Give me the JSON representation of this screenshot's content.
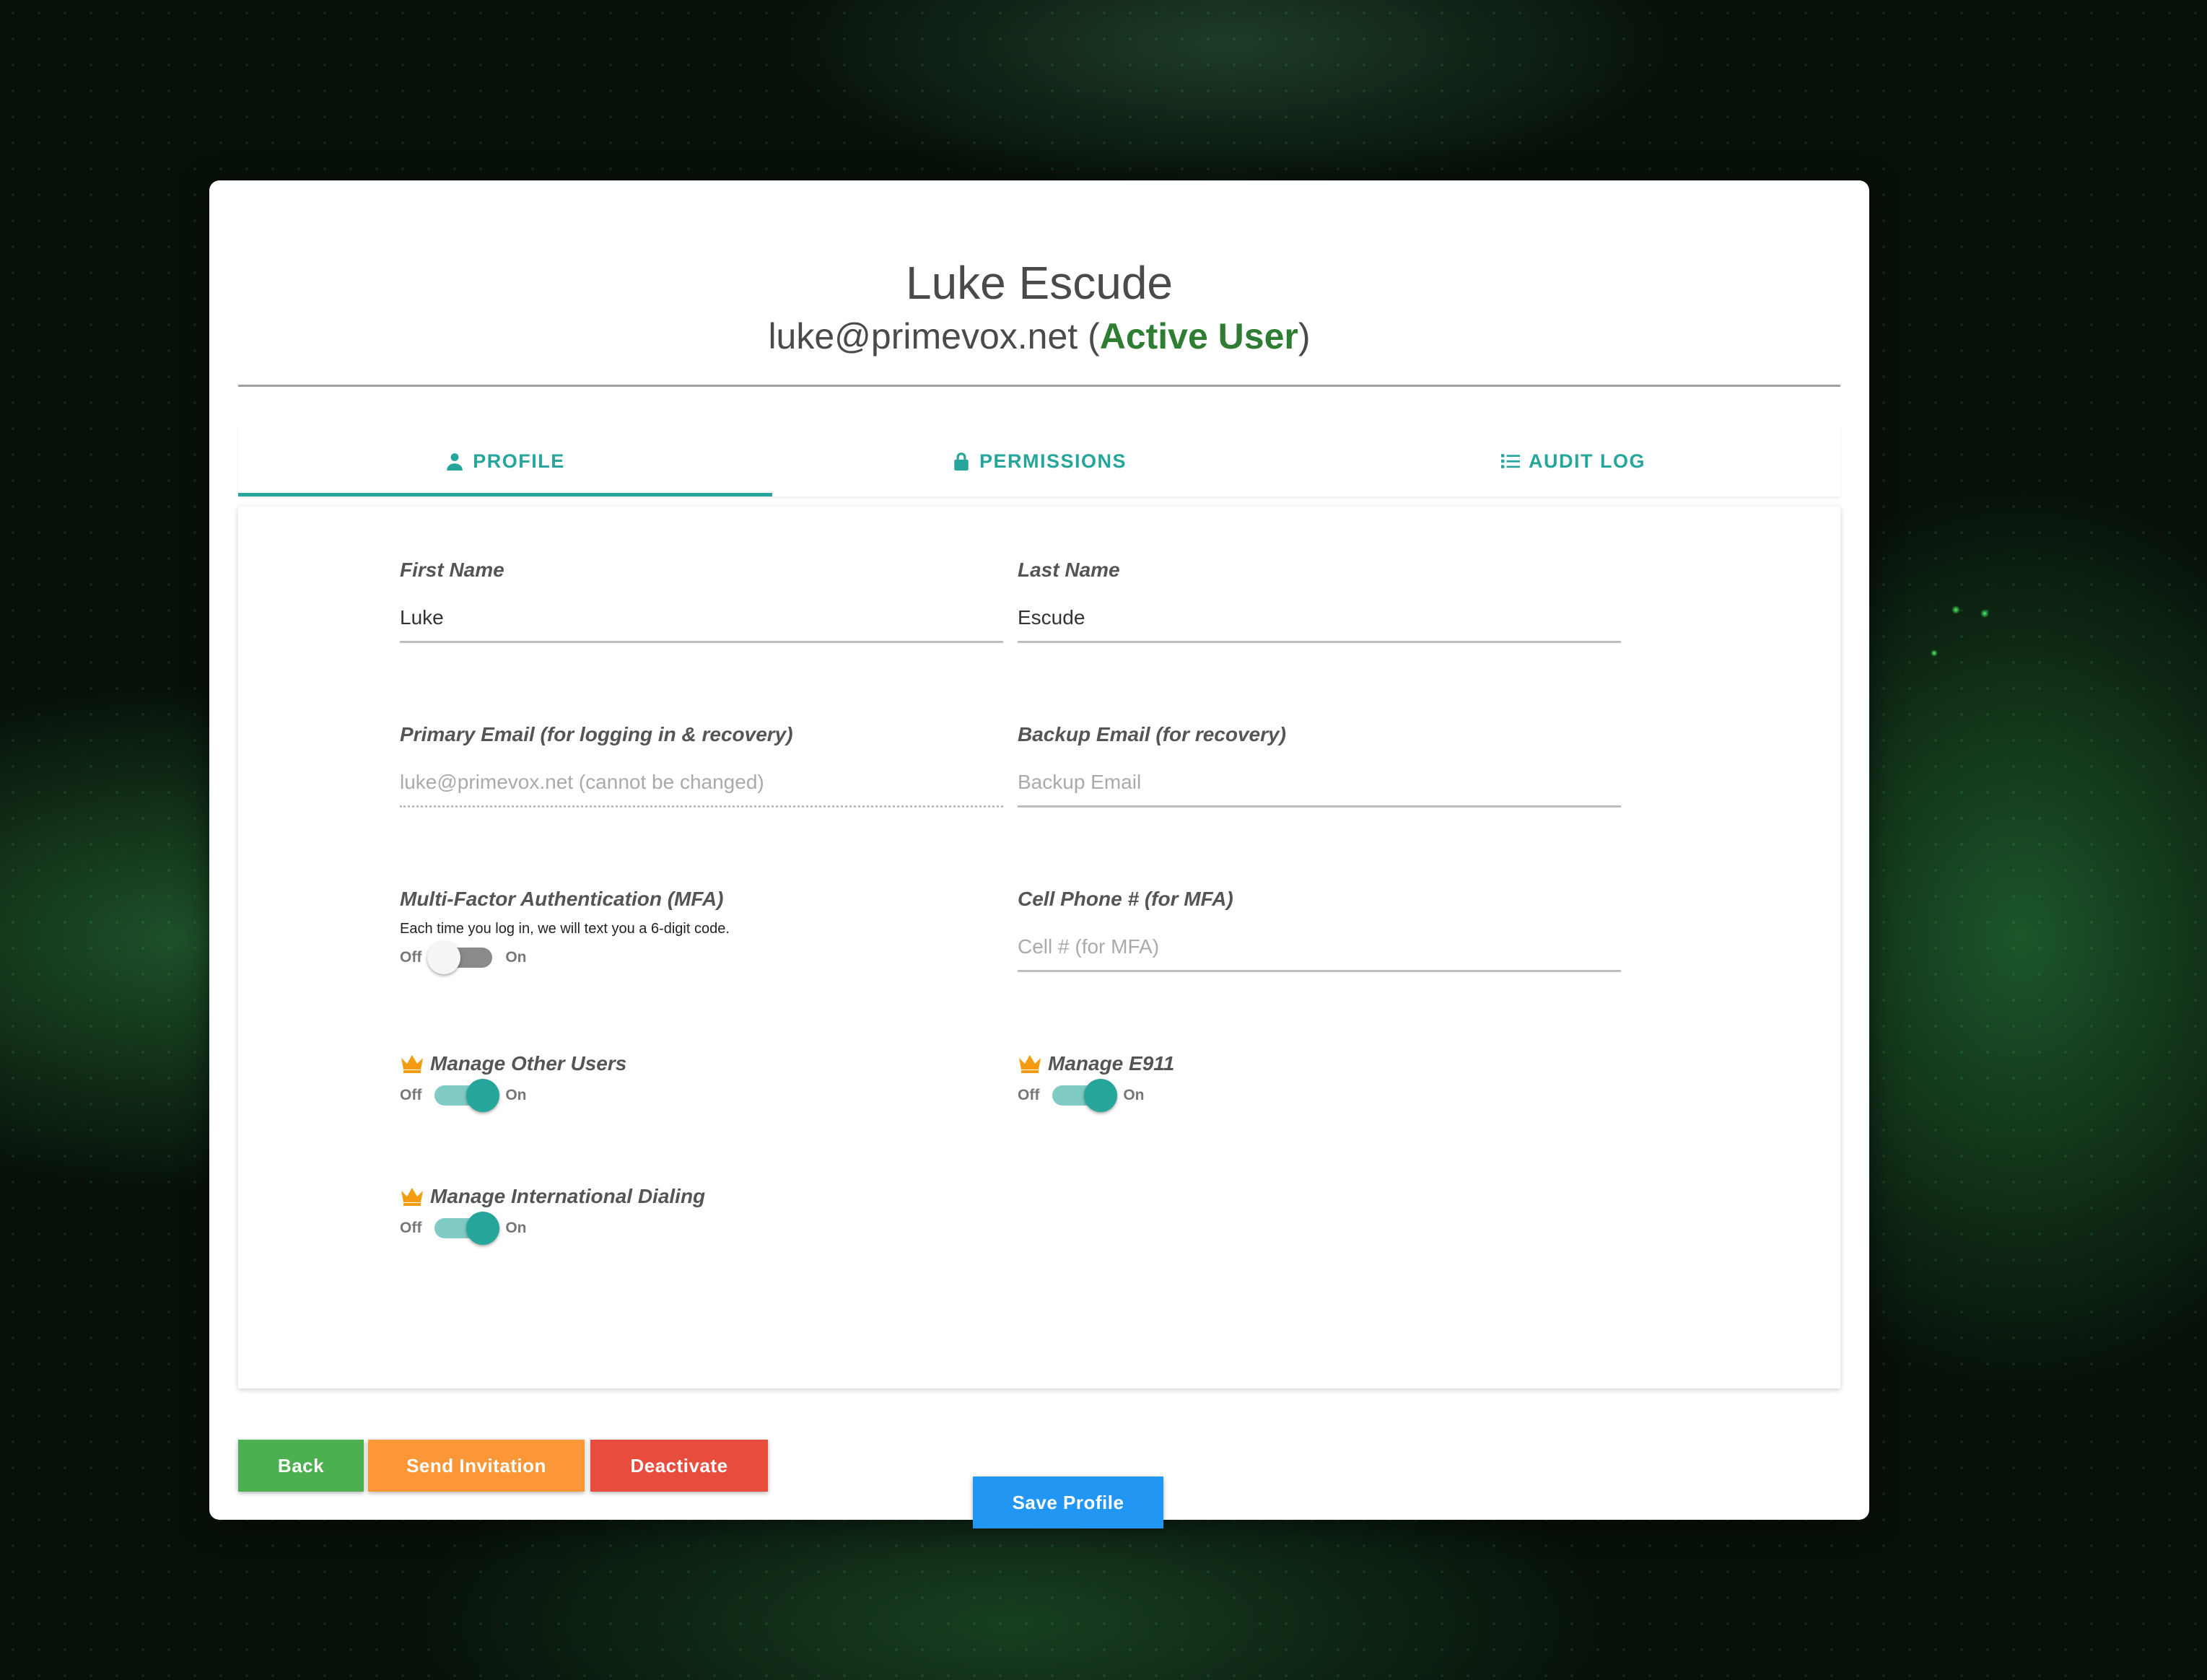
{
  "user": {
    "full_name": "Luke Escude",
    "email": "luke@primevox.net",
    "status": "Active User",
    "status_color": "#2e7d32"
  },
  "tabs": [
    {
      "label": "PROFILE",
      "icon": "user-icon",
      "active": true
    },
    {
      "label": "PERMISSIONS",
      "icon": "lock-icon",
      "active": false
    },
    {
      "label": "AUDIT LOG",
      "icon": "list-icon",
      "active": false
    }
  ],
  "profile": {
    "first_name": {
      "label": "First Name",
      "value": "Luke"
    },
    "last_name": {
      "label": "Last Name",
      "value": "Escude"
    },
    "primary_email": {
      "label": "Primary Email (for logging in & recovery)",
      "placeholder": "luke@primevox.net (cannot be changed)"
    },
    "backup_email": {
      "label": "Backup Email (for recovery)",
      "placeholder": "Backup Email"
    },
    "mfa": {
      "label": "Multi-Factor Authentication (MFA)",
      "help": "Each time you log in, we will text you a 6-digit code.",
      "enabled": false
    },
    "cell_phone": {
      "label": "Cell Phone # (for MFA)",
      "placeholder": "Cell # (for MFA)"
    }
  },
  "permissions": {
    "manage_users": {
      "label": "Manage Other Users",
      "enabled": true,
      "icon": "crown-icon"
    },
    "manage_e911": {
      "label": "Manage E911",
      "enabled": true,
      "icon": "crown-icon"
    },
    "manage_intl": {
      "label": "Manage International Dialing",
      "enabled": true,
      "icon": "crown-icon"
    }
  },
  "toggle": {
    "off": "Off",
    "on": "On"
  },
  "actions": {
    "save": "Save Profile",
    "back": "Back",
    "send_invitation": "Send Invitation",
    "deactivate": "Deactivate"
  },
  "colors": {
    "accent": "#26a69a",
    "save": "#2196f3",
    "back": "#4caf50",
    "invite": "#fb9737",
    "deactivate": "#e74c3c",
    "crown": "#f39c12"
  }
}
